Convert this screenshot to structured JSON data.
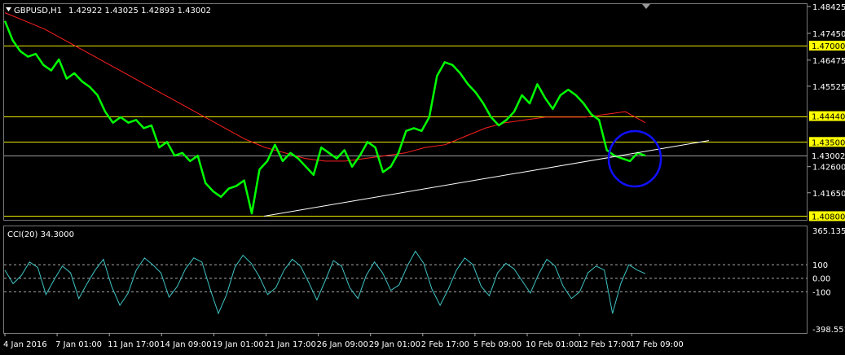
{
  "header": {
    "symbol": "GBPUSD,H1",
    "quote": "1.42922 1.43025 1.42893 1.43002"
  },
  "indicator": {
    "label": "CCI(20) 34.3000",
    "ticks": [
      "365.1359",
      "100",
      "0.00",
      "-100",
      "-398.5519"
    ]
  },
  "colors": {
    "background": "#000000",
    "price": "#00ff00",
    "ma": "#ff2020",
    "level": "#e8e800",
    "trendline": "#ffffff",
    "cci": "#3fc4c4",
    "highlight": "#1010ff",
    "label_bg": "#ffff00"
  },
  "chart_data": {
    "type": "line",
    "symbol": "GBPUSD",
    "timeframe": "H1",
    "price_axis_ticks": [
      "1.48425",
      "1.47450",
      "1.46475",
      "1.45525",
      "1.42600",
      "1.41650"
    ],
    "ylim": [
      1.40725,
      1.48425
    ],
    "x_ticks": [
      "4 Jan 2016",
      "7 Jan 01:00",
      "11 Jan 17:00",
      "14 Jan 09:00",
      "19 Jan 01:00",
      "21 Jan 17:00",
      "26 Jan 09:00",
      "29 Jan 01:00",
      "2 Feb 17:00",
      "5 Feb 09:00",
      "10 Feb 01:00",
      "12 Feb 17:00",
      "17 Feb 09:00"
    ],
    "horizontal_levels": [
      {
        "value": 1.47,
        "label": "1.47000"
      },
      {
        "value": 1.4444,
        "label": "1.44440"
      },
      {
        "value": 1.435,
        "label": "1.43500"
      },
      {
        "value": 1.408,
        "label": "1.40800"
      }
    ],
    "current_price": {
      "value": 1.43002,
      "label": "1.43002"
    },
    "trendline": {
      "from": {
        "x": "20 Jan",
        "y": 1.408
      },
      "to": {
        "x": "19 Feb",
        "y": 1.4355
      }
    },
    "series": [
      {
        "values": [
          1.479,
          1.472,
          1.468,
          1.466,
          1.467,
          1.463,
          1.461,
          1.465,
          1.458,
          1.46,
          1.457,
          1.455,
          1.452,
          1.446,
          1.442,
          1.444,
          1.442,
          1.443,
          1.44,
          1.441,
          1.433,
          1.435,
          1.43,
          1.431,
          1.428,
          1.43,
          1.42,
          1.417,
          1.415,
          1.418,
          1.419,
          1.421,
          1.409,
          1.425,
          1.428,
          1.434,
          1.428,
          1.431,
          1.429,
          1.426,
          1.423,
          1.433,
          1.431,
          1.429,
          1.432,
          1.426,
          1.43,
          1.435,
          1.433,
          1.424,
          1.426,
          1.431,
          1.439,
          1.44,
          1.439,
          1.444,
          1.459,
          1.464,
          1.463,
          1.46,
          1.456,
          1.453,
          1.449,
          1.444,
          1.441,
          1.443,
          1.446,
          1.452,
          1.449,
          1.456,
          1.451,
          1.447,
          1.452,
          1.454,
          1.452,
          1.449,
          1.445,
          1.443,
          1.432,
          1.43,
          1.429,
          1.428,
          1.431,
          1.43
        ]
      },
      {
        "values": [
          1.482,
          1.479,
          1.476,
          1.472,
          1.468,
          1.464,
          1.46,
          1.456,
          1.452,
          1.448,
          1.444,
          1.44,
          1.436,
          1.433,
          1.431,
          1.429,
          1.428,
          1.428,
          1.429,
          1.43,
          1.431,
          1.433,
          1.434,
          1.437,
          1.44,
          1.442,
          1.443,
          1.444,
          1.444,
          1.444,
          1.445,
          1.446,
          1.442
        ]
      }
    ],
    "cci": {
      "values": [
        60,
        -40,
        20,
        120,
        80,
        -120,
        -10,
        90,
        40,
        -150,
        -40,
        60,
        140,
        -60,
        -200,
        -110,
        60,
        150,
        100,
        40,
        -140,
        -60,
        70,
        150,
        120,
        -80,
        -260,
        -120,
        80,
        170,
        110,
        10,
        -120,
        -70,
        60,
        140,
        90,
        -30,
        -160,
        -20,
        130,
        90,
        -70,
        -150,
        20,
        120,
        40,
        -90,
        -50,
        90,
        200,
        110,
        -80,
        -200,
        -80,
        60,
        150,
        100,
        -60,
        -130,
        40,
        110,
        70,
        -20,
        -110,
        30,
        140,
        90,
        -60,
        -150,
        -100,
        40,
        90,
        60,
        -260,
        -40,
        100,
        60,
        34
      ],
      "levels": [
        100,
        0,
        -100
      ],
      "ylim": [
        -398.5519,
        365.1359
      ]
    }
  }
}
